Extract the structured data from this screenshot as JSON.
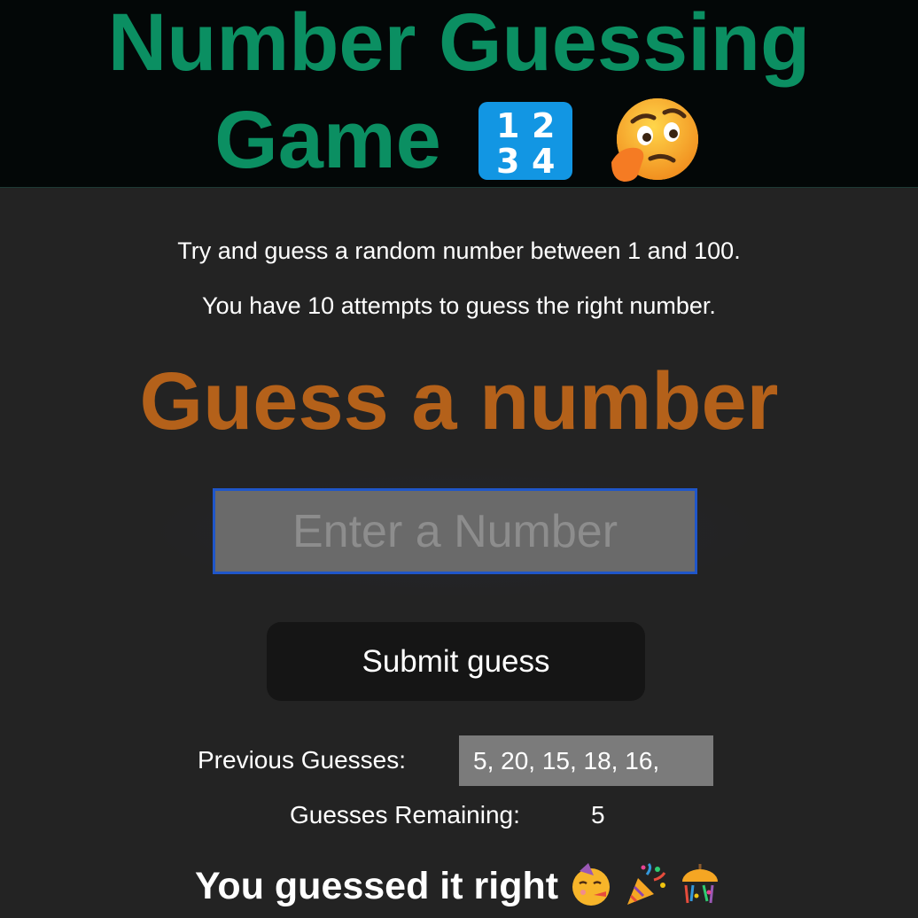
{
  "header": {
    "title_line1": "Number Guessing",
    "title_line2": "Game",
    "icons": [
      "input-numbers-icon",
      "thinking-face-icon"
    ]
  },
  "description": {
    "line1": "Try and guess a random number between 1 and 100.",
    "line2": "You have 10 attempts to guess the right number."
  },
  "guess": {
    "heading": "Guess a number",
    "input_value": "",
    "input_placeholder": "Enter a Number",
    "submit_label": "Submit guess"
  },
  "status": {
    "previous_label": "Previous Guesses:",
    "previous_values": "5, 20, 15, 18, 16,",
    "remaining_label": "Guesses Remaining:",
    "remaining_value": "5"
  },
  "result": {
    "message": "You guessed it right",
    "icons": [
      "partying-face-icon",
      "party-popper-icon",
      "confetti-ball-icon"
    ]
  },
  "colors": {
    "title": "#0b8f62",
    "heading": "#b4611a",
    "header_bg": "#030707",
    "page_bg": "#232323",
    "input_border": "#1f56c9",
    "input_bg": "#6a6a6a",
    "button_bg": "#151515",
    "previous_bg": "#7b7b7b"
  }
}
